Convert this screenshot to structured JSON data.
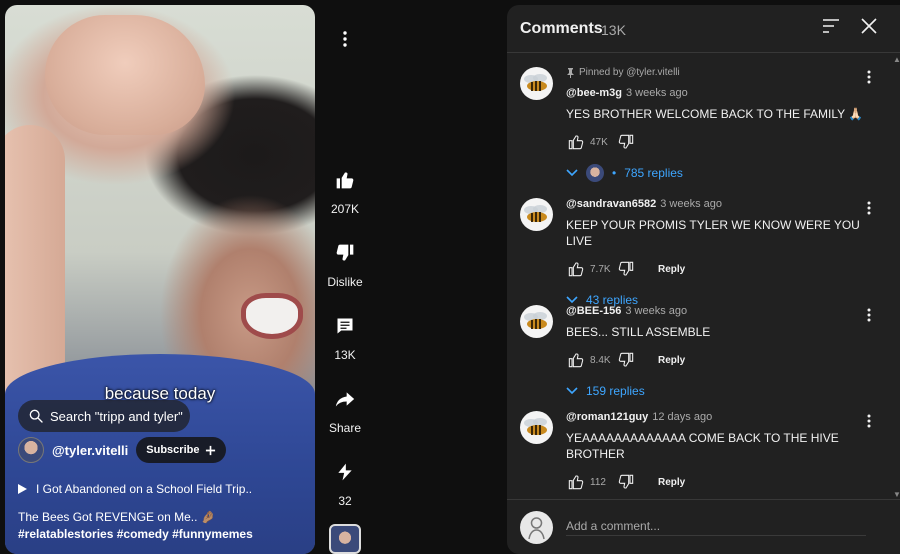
{
  "video": {
    "caption": "because today",
    "search_label": "Search \"tripp and tyler\"",
    "channel_name": "@tyler.vitelli",
    "subscribe_label": "Subscribe",
    "playlist_label": "I Got Abandoned on a School Field Trip..",
    "title_text": "The Bees Got REVENGE on Me.. 🤌🏽 ",
    "title_tags": "#relatablestories #comedy #funnymemes"
  },
  "actions": {
    "like_count": "207K",
    "dislike_label": "Dislike",
    "comment_count": "13K",
    "share_label": "Share",
    "remix_count": "32"
  },
  "comments_panel": {
    "title": "Comments",
    "count": "13K",
    "add_placeholder": "Add a comment...",
    "comments": [
      {
        "pinned_label": "Pinned by @tyler.vitelli",
        "username": "@bee-m3g",
        "time": "3 weeks ago",
        "text": "YES BROTHER WELCOME BACK TO THE FAMILY 🙏🏻",
        "likes": "47K",
        "reply_label": "",
        "replies_label": "785 replies"
      },
      {
        "username": "@sandravan6582",
        "time": "3 weeks ago",
        "text": "KEEP YOUR PROMIS TYLER WE KNOW WERE YOU LIVE",
        "likes": "7.7K",
        "reply_label": "Reply",
        "replies_label": "43 replies"
      },
      {
        "username": "@BEE-156",
        "time": "3 weeks ago",
        "text": "BEES... STILL ASSEMBLE",
        "likes": "8.4K",
        "reply_label": "Reply",
        "replies_label": "159 replies"
      },
      {
        "username": "@roman121guy",
        "time": "12 days ago",
        "text": "YEAAAAAAAAAAAAA COME BACK TO THE HIVE BROTHER",
        "likes": "112",
        "reply_label": "Reply"
      }
    ]
  },
  "icons": {
    "video_more": "more-vert-icon",
    "like": "thumb-up-icon",
    "dislike": "thumb-down-icon",
    "comment": "comment-icon",
    "share": "share-icon",
    "remix": "remix-icon",
    "sort": "sort-icon",
    "close": "close-icon",
    "search": "search-icon",
    "play": "play-icon"
  },
  "colors": {
    "background": "#0f0f0f",
    "panel": "#212121",
    "link_blue": "#3ea6ff",
    "text": "#f1f1f1",
    "muted": "#aaaaaa"
  }
}
